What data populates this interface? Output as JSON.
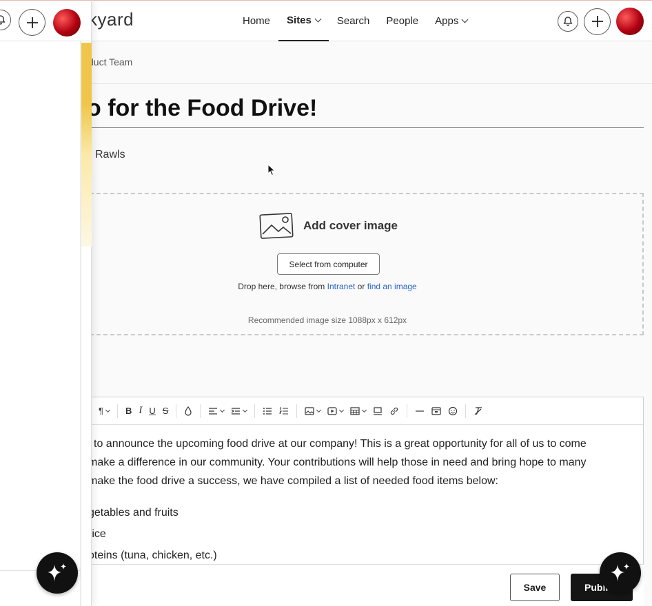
{
  "header": {
    "logo_text": "kyard",
    "nav": [
      {
        "label": "Home"
      },
      {
        "label": "Sites"
      },
      {
        "label": "Search"
      },
      {
        "label": "People"
      },
      {
        "label": "Apps"
      }
    ]
  },
  "breadcrumb": "duct Team",
  "page": {
    "title": "o for the Food Drive!",
    "author": "Rawls"
  },
  "cover": {
    "label": "Add cover image",
    "select_button": "Select from computer",
    "drop_prefix": "Drop here, browse from ",
    "drop_link_intranet": "Intranet",
    "drop_or": " or ",
    "drop_link_find": "find an image",
    "recommendation": "Recommended image size 1088px x 612px"
  },
  "editor": {
    "paragraph_lines": [
      "l to announce the upcoming food drive at our company! This is a great opportunity for all of us to come",
      "make a difference in our community. Your contributions will help those in need and bring hope to many",
      "make the food drive a success, we have compiled a list of needed food items below:"
    ],
    "list_items": [
      "getables and fruits",
      "rice",
      "oteins (tuna, chicken, etc.)"
    ],
    "toolbar_icons": [
      "paragraph-icon",
      "bold-icon",
      "italic-icon",
      "underline-icon",
      "strikethrough-icon",
      "text-color-icon",
      "align-icon",
      "indent-icon",
      "bullet-list-icon",
      "numbered-list-icon",
      "image-icon",
      "video-icon",
      "table-icon",
      "embed-icon",
      "link-icon",
      "horizontal-rule-icon",
      "widget-icon",
      "emoji-icon",
      "clear-format-icon"
    ]
  },
  "footer": {
    "save_label": "Save",
    "publish_label": "Publi"
  },
  "colors": {
    "accent_link": "#2b63c6",
    "primary_button": "#151515",
    "avatar": "#b00010"
  }
}
